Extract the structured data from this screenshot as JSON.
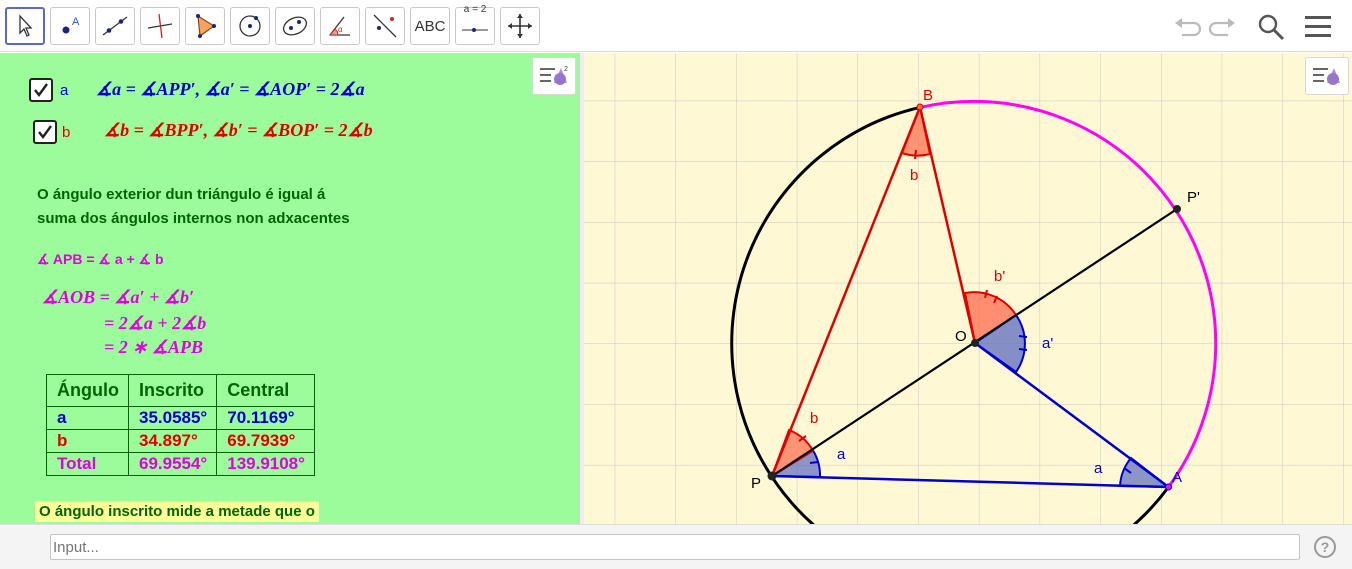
{
  "toolbar": {
    "tools": [
      "move",
      "point",
      "line",
      "perpendicular",
      "polygon",
      "circle",
      "conic",
      "angle",
      "reflect",
      "text",
      "slider",
      "move-graphics"
    ],
    "text_tool_label": "ABC",
    "slider_tool_label": "a = 2"
  },
  "algebra": {
    "checkbox_a": {
      "label": "a",
      "checked": true,
      "formula": "∡a = ∡APP′,   ∡a′ = ∡AOP′ = 2∡a"
    },
    "checkbox_b": {
      "label": "b",
      "checked": true,
      "formula": "∡b = ∡BPP′,   ∡b′ = ∡BOP′ = 2∡b"
    },
    "text_exterior_line1": "O ángulo exterior dun triángulo é igual á",
    "text_exterior_line2": "suma dos ángulos internos non adxacentes",
    "text_apb": "∡ APB = ∡ a + ∡ b",
    "eq_line1": "∡AOB = ∡a′ + ∡b′",
    "eq_line2": "= 2∡a + 2∡b",
    "eq_line3": "= 2 ∗ ∡APB",
    "table": {
      "headers": [
        "Ángulo",
        "Inscrito",
        "Central"
      ],
      "rows": [
        {
          "name": "a",
          "inscrito": "35.0585°",
          "central": "70.1169°"
        },
        {
          "name": "b",
          "inscrito": "34.897°",
          "central": "69.7939°"
        },
        {
          "name": "Total",
          "inscrito": "69.9554°",
          "central": "139.9108°"
        }
      ]
    },
    "note": "O ángulo inscrito mide a metade que o"
  },
  "graphics": {
    "points": {
      "B": "B",
      "P": "P",
      "P_prime": "P'",
      "O": "O",
      "A": "A"
    },
    "angle_labels": {
      "a_at_P": "a",
      "b_at_P": "b",
      "a_at_A": "a",
      "b_at_B": "b",
      "a_prime": "a'",
      "b_prime": "b'"
    }
  },
  "input": {
    "placeholder": "Input..."
  },
  "help_label": "?",
  "colors": {
    "a": "#0000cc",
    "b": "#e00000",
    "total": "#e000e0",
    "text_green": "#006400",
    "panel_green": "#9cfc9c",
    "graphics_bg": "#fff8d4",
    "arc_magenta": "#ff00ff"
  }
}
